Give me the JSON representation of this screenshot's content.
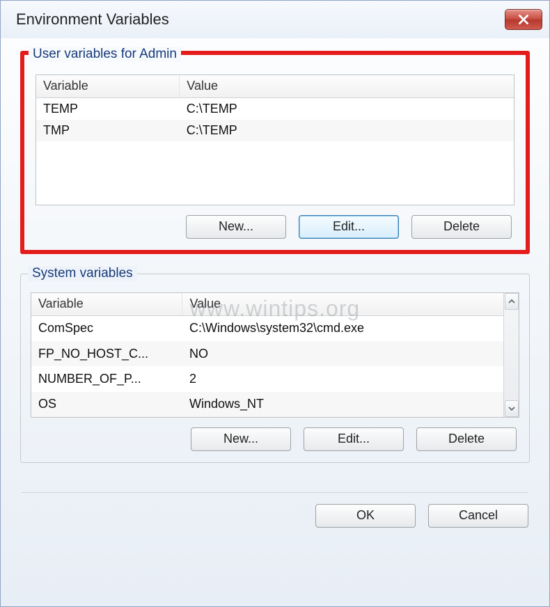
{
  "window": {
    "title": "Environment Variables"
  },
  "user_vars": {
    "group_title": "User variables for Admin",
    "columns": {
      "variable": "Variable",
      "value": "Value"
    },
    "rows": [
      {
        "variable": "TEMP",
        "value": "C:\\TEMP"
      },
      {
        "variable": "TMP",
        "value": "C:\\TEMP"
      }
    ],
    "buttons": {
      "new": "New...",
      "edit": "Edit...",
      "delete": "Delete"
    }
  },
  "system_vars": {
    "group_title": "System variables",
    "columns": {
      "variable": "Variable",
      "value": "Value"
    },
    "rows": [
      {
        "variable": "ComSpec",
        "value": "C:\\Windows\\system32\\cmd.exe"
      },
      {
        "variable": "FP_NO_HOST_C...",
        "value": "NO"
      },
      {
        "variable": "NUMBER_OF_P...",
        "value": "2"
      },
      {
        "variable": "OS",
        "value": "Windows_NT"
      }
    ],
    "buttons": {
      "new": "New...",
      "edit": "Edit...",
      "delete": "Delete"
    }
  },
  "footer": {
    "ok": "OK",
    "cancel": "Cancel"
  },
  "watermark": "www.wintips.org"
}
